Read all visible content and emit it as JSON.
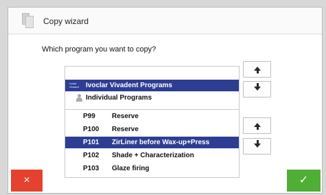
{
  "window": {
    "title": "Copy wizard",
    "icon": "copy-documents-icon"
  },
  "question": "Which program you want to copy?",
  "groups": [
    {
      "label": "Ivoclar Vivadent Programs",
      "logo_text": "Ivoclar Vivadent",
      "icon": "ivoclar-logo-icon",
      "selected": true
    },
    {
      "label": "Individual Programs",
      "icon": "person-icon",
      "selected": false
    }
  ],
  "programs": [
    {
      "number": "P99",
      "name": "Reserve",
      "selected": false
    },
    {
      "number": "P100",
      "name": "Reserve",
      "selected": false
    },
    {
      "number": "P101",
      "name": "ZirLiner before Wax-up+Press",
      "selected": true
    },
    {
      "number": "P102",
      "name": "Shade + Characterization",
      "selected": false
    },
    {
      "number": "P103",
      "name": "Glaze firing",
      "selected": false
    }
  ],
  "buttons": {
    "group_up_icon": "arrow-up-icon",
    "group_down_icon": "arrow-down-icon",
    "program_up_icon": "arrow-up-icon",
    "program_down_icon": "arrow-down-icon",
    "cancel_symbol": "×",
    "confirm_symbol": "✓"
  },
  "colors": {
    "selection": "#2e3d94",
    "cancel": "#e4412f",
    "confirm": "#4fae36"
  }
}
